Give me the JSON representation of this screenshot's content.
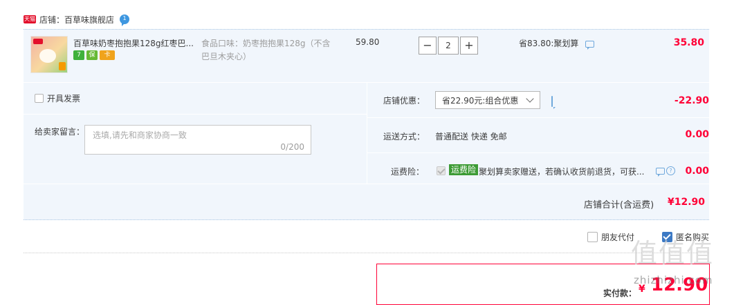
{
  "store": {
    "badge": "天猫",
    "name": "店铺：百草味旗舰店",
    "chat_badge": "1"
  },
  "item": {
    "title": "百草味奶枣抱抱果128g红枣巴...",
    "service_icons": [
      "7",
      "保",
      "卡"
    ],
    "sku": "食品口味：奶枣抱抱果128g（不含巴旦木夹心）",
    "unit_price": "59.80",
    "quantity": "2",
    "minus": "−",
    "plus": "+",
    "save_text": "省83.80:聚划算",
    "subtotal": "35.80"
  },
  "invoice": {
    "label": "开具发票"
  },
  "message": {
    "label": "给卖家留言：",
    "placeholder": "选填,请先和商家协商一致",
    "count": "0/200"
  },
  "discount": {
    "label": "店铺优惠：",
    "selected": "省22.90元:组合优惠",
    "amount": "-22.90"
  },
  "shipping": {
    "label": "运送方式：",
    "value": "普通配送 快递 免邮",
    "amount": "0.00"
  },
  "insurance": {
    "label": "运费险：",
    "badge": "运费险",
    "desc": "聚划算卖家赠送，若确认收货前退货，可获...",
    "help": "?",
    "amount": "0.00"
  },
  "store_total": {
    "label": "店铺合计(含运费)",
    "value": "¥12.90"
  },
  "options": {
    "friend_pay": "朋友代付",
    "anonymous": "匿名购买"
  },
  "payment": {
    "label": "实付款：",
    "currency": "¥",
    "value": "12.90"
  },
  "watermark": {
    "chars": "值值值",
    "url": "zhizhizhi.com"
  },
  "colors": {
    "accent_red": "#ff0036",
    "panel_bg": "#f1f6fc",
    "check_blue": "#3c79c4",
    "insurance_green": "#3d9b35"
  }
}
